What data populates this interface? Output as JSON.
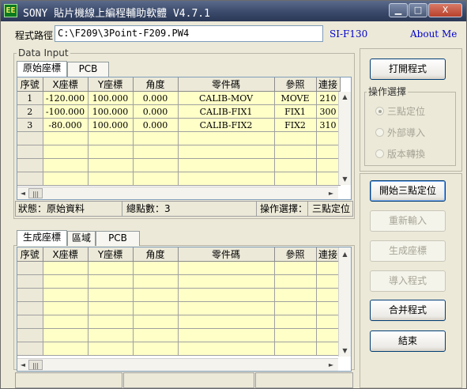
{
  "window": {
    "app_icon": "EE",
    "title": "SONY 貼片機線上編程輔助軟體 V4.7.1",
    "min": "▁",
    "max": "□",
    "close": "X"
  },
  "path": {
    "label": "程式路徑",
    "value": "C:\\F209\\3Point-F209.PW4",
    "model": "SI-F130",
    "about": "About Me"
  },
  "data_input": {
    "title": "Data Input",
    "tabs": [
      "原始座標",
      "PCB"
    ],
    "columns": [
      "序號",
      "X座標",
      "Y座標",
      "角度",
      "零件碼",
      "參照",
      "連接"
    ],
    "rows": [
      [
        "1",
        "-120.000",
        "100.000",
        "0.000",
        "CALIB-MOV",
        "MOVE",
        "210"
      ],
      [
        "2",
        "-100.000",
        "100.000",
        "0.000",
        "CALIB-FIX1",
        "FIX1",
        "300"
      ],
      [
        "3",
        "-80.000",
        "100.000",
        "0.000",
        "CALIB-FIX2",
        "FIX2",
        "310"
      ]
    ],
    "status": {
      "state": "狀態：原始資料",
      "count": "總點數：3",
      "mode_label": "操作選擇：",
      "mode_value": "三點定位"
    }
  },
  "output": {
    "tabs": [
      "生成座標",
      "區域",
      "PCB"
    ],
    "columns": [
      "序號",
      "X座標",
      "Y座標",
      "角度",
      "零件碼",
      "參照",
      "連接"
    ]
  },
  "buttons": {
    "open": "打開程式",
    "start": "開始三點定位",
    "reinput": "重新輸入",
    "generate": "生成座標",
    "import": "導入程式",
    "merge": "合并程式",
    "end": "結束"
  },
  "operation": {
    "title": "操作選擇",
    "options": [
      {
        "label": "三點定位",
        "selected": true
      },
      {
        "label": "外部導入",
        "selected": false
      },
      {
        "label": "版本轉換",
        "selected": false
      }
    ]
  },
  "scroll_glyphs": {
    "up": "▲",
    "down": "▼",
    "left": "◄",
    "right": "►",
    "thumb": "|||"
  }
}
